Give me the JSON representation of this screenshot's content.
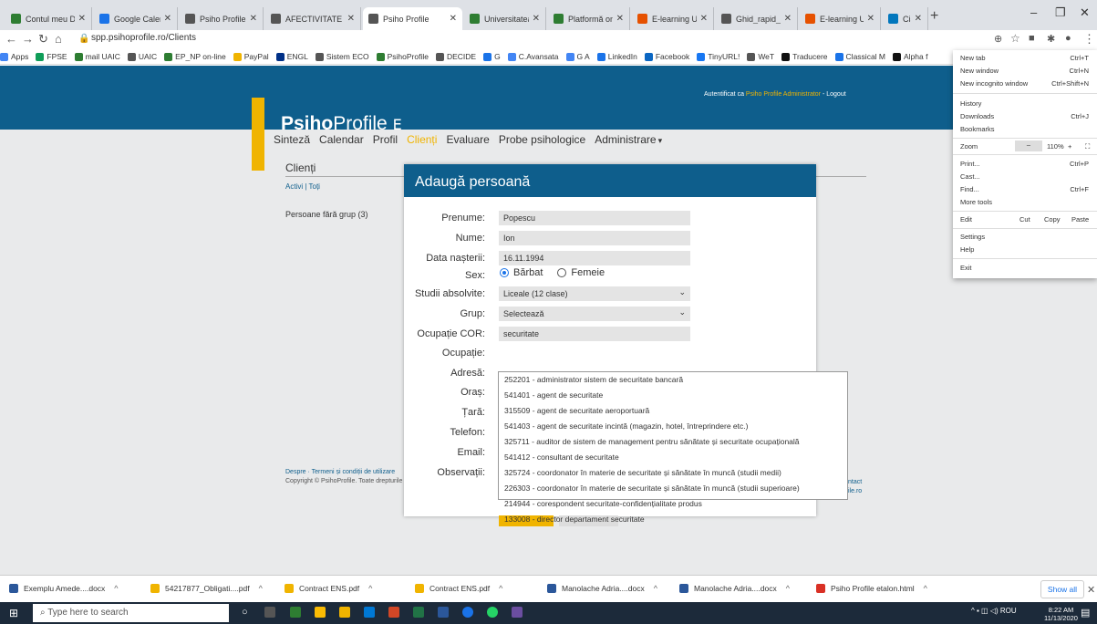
{
  "browser": {
    "tabs": [
      {
        "title": "Contul meu Drive",
        "color": "#2e7d32"
      },
      {
        "title": "Google Calendar",
        "color": "#1a73e8"
      },
      {
        "title": "Psiho Profile",
        "color": "#555555"
      },
      {
        "title": "AFECTIVITATE / E",
        "color": "#555555"
      },
      {
        "title": "Psiho Profile",
        "color": "#555555"
      },
      {
        "title": "Universitatea „A",
        "color": "#2e7d32"
      },
      {
        "title": "Platformă online",
        "color": "#2e7d32"
      },
      {
        "title": "E-learning UAIC",
        "color": "#e65100"
      },
      {
        "title": "Ghid_rapid_Mod",
        "color": "#555555"
      },
      {
        "title": "E-learning UAIC",
        "color": "#e65100"
      },
      {
        "title": "Cisco Webex Me",
        "color": "#0277bd"
      }
    ],
    "new_tab": "+",
    "minimize": "–",
    "restore": "❐",
    "close": "✕",
    "url": "spp.psihoprofile.ro/Clients",
    "bookmarks": [
      "Apps",
      "FPSE",
      "mail UAIC",
      "UAIC",
      "EP_NP on-line",
      "PayPal",
      "ENGL",
      "Sistem ECO",
      "PsihoProfile",
      "DECIDE",
      "G",
      "C.Avansata",
      "G A",
      "LinkedIn",
      "Facebook",
      "TinyURL!",
      "WeT",
      "Traducere",
      "Classical M",
      "Alpha f"
    ]
  },
  "site": {
    "logo_bold": "Psiho",
    "logo_rest": "Profile",
    "auth_prefix": "Autentificat ca",
    "auth_user": "Psiho Profile Administrator",
    "auth_logout": "- Logout",
    "nav": [
      "Sinteză",
      "Calendar",
      "Profil",
      "Clienți",
      "Evaluare",
      "Probe psihologice",
      "Administrare"
    ],
    "nav_current_index": 3,
    "clienti_heading": "Clienți",
    "clienti_sub": "Activi | Toți",
    "persons_group": "Persoane fără grup (3)",
    "footer_links": "Despre · Termeni și condiții de utilizare",
    "footer_copy": "Copyright © PsihoProfile. Toate drepturile",
    "footer_right_1": "ntact",
    "footer_right_2": "ile.ro"
  },
  "modal": {
    "title": "Adaugă persoană",
    "labels": {
      "prenume": "Prenume:",
      "nume": "Nume:",
      "data_nasterii": "Data nașterii:",
      "sex": "Sex:",
      "studii": "Studii absolvite:",
      "grup": "Grup:",
      "ocupatie_cor": "Ocupație COR:",
      "ocupatie": "Ocupație:",
      "adresa": "Adresă:",
      "oras": "Oraș:",
      "tara": "Țară:",
      "telefon": "Telefon:",
      "email": "Email:",
      "observatii": "Observații:"
    },
    "values": {
      "prenume": "Popescu",
      "nume": "Ion",
      "data_nasterii": "16.11.1994",
      "sex_male": "Bărbat",
      "sex_female": "Femeie",
      "studii": "Liceale (12 clase)",
      "grup": "Selectează",
      "ocupatie_cor": "securitate"
    },
    "autocomplete": [
      "252201 - administrator sistem de securitate bancară",
      "541401 - agent de securitate",
      "315509 - agent de securitate aeroportuară",
      "541403 - agent de securitate incintă (magazin, hotel, întreprindere etc.)",
      "325711 - auditor de sistem de management pentru sănătate și securitate ocupațională",
      "541412 - consultant de securitate",
      "325724 - coordonator în materie de securitate și sănătate în muncă (studii medii)",
      "226303 - coordonator în materie de securitate și sănătate în muncă (studii superioare)",
      "214944 - corespondent securitate-confidențialitate produs",
      "133008 - director departament securitate"
    ]
  },
  "chrome_menu": {
    "new_tab": "New tab",
    "new_tab_sc": "Ctrl+T",
    "new_window": "New window",
    "new_window_sc": "Ctrl+N",
    "incognito": "New incognito window",
    "incognito_sc": "Ctrl+Shift+N",
    "history": "History",
    "downloads": "Downloads",
    "downloads_sc": "Ctrl+J",
    "bookmarks": "Bookmarks",
    "zoom": "Zoom",
    "zoom_minus": "–",
    "zoom_value": "110%",
    "zoom_plus": "+",
    "print": "Print...",
    "print_sc": "Ctrl+P",
    "cast": "Cast...",
    "find": "Find...",
    "find_sc": "Ctrl+F",
    "more_tools": "More tools",
    "edit": "Edit",
    "cut": "Cut",
    "copy": "Copy",
    "paste": "Paste",
    "settings": "Settings",
    "help": "Help",
    "exit": "Exit"
  },
  "downloads": [
    {
      "name": "Exemplu Amede....docx",
      "color": "#2b579a"
    },
    {
      "name": "54217877_Obligati....pdf",
      "color": "#f0b400"
    },
    {
      "name": "Contract ENS.pdf",
      "color": "#f0b400"
    },
    {
      "name": "Contract ENS.pdf",
      "color": "#f0b400"
    },
    {
      "name": "Manolache Adria....docx",
      "color": "#2b579a"
    },
    {
      "name": "Manolache Adria....docx",
      "color": "#2b579a"
    },
    {
      "name": "Psiho Profile etalon.html",
      "color": "#d93025"
    }
  ],
  "show_all": "Show all",
  "taskbar": {
    "search_placeholder": "Type here to search",
    "tray_lang": "ROU",
    "time": "8:22 AM",
    "date": "11/13/2020"
  }
}
